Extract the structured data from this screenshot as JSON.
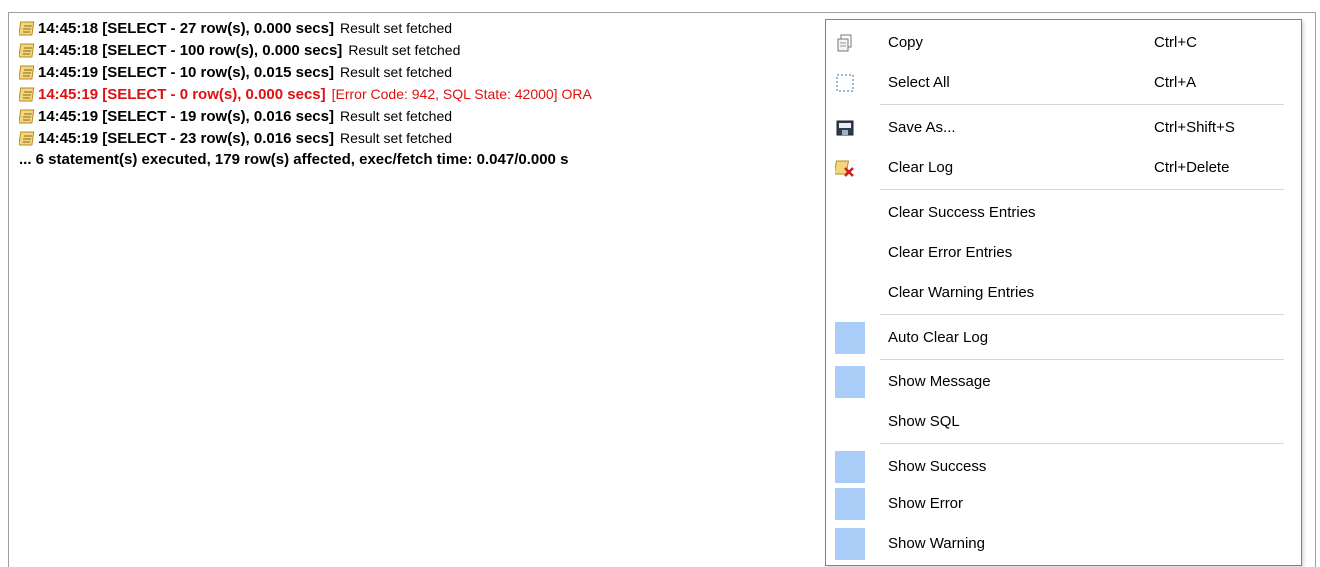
{
  "log": {
    "lines": [
      {
        "stamp": "14:45:18  [SELECT - 27 row(s), 0.000 secs]",
        "message": "Result set fetched",
        "error": false
      },
      {
        "stamp": "14:45:18  [SELECT - 100 row(s), 0.000 secs]",
        "message": "Result set fetched",
        "error": false
      },
      {
        "stamp": "14:45:19  [SELECT - 10 row(s), 0.015 secs]",
        "message": "Result set fetched",
        "error": false
      },
      {
        "stamp": "14:45:19  [SELECT - 0 row(s), 0.000 secs]",
        "message": "[Error Code: 942, SQL State: 42000]  ORA",
        "error": true
      },
      {
        "stamp": "14:45:19  [SELECT - 19 row(s), 0.016 secs]",
        "message": "Result set fetched",
        "error": false
      },
      {
        "stamp": "14:45:19  [SELECT - 23 row(s), 0.016 secs]",
        "message": "Result set fetched",
        "error": false
      }
    ],
    "summary": "... 6 statement(s) executed, 179 row(s) affected, exec/fetch time: 0.047/0.000 s"
  },
  "menu": {
    "copy": {
      "label": "Copy",
      "shortcut": "Ctrl+C",
      "icon": "copy-icon"
    },
    "select_all": {
      "label": "Select All",
      "shortcut": "Ctrl+A",
      "icon": "select-all-icon"
    },
    "save_as": {
      "label": "Save As...",
      "shortcut": "Ctrl+Shift+S",
      "icon": "save-icon"
    },
    "clear_log": {
      "label": "Clear Log",
      "shortcut": "Ctrl+Delete",
      "icon": "clear-log-icon"
    },
    "clear_success": {
      "label": "Clear Success Entries"
    },
    "clear_error": {
      "label": "Clear Error Entries"
    },
    "clear_warning": {
      "label": "Clear Warning Entries"
    },
    "auto_clear": {
      "label": "Auto Clear Log",
      "checked": true
    },
    "show_message": {
      "label": "Show Message",
      "checked": true
    },
    "show_sql": {
      "label": "Show SQL",
      "checked": false
    },
    "show_success": {
      "label": "Show Success",
      "checked": true
    },
    "show_error": {
      "label": "Show Error",
      "checked": true
    },
    "show_warning": {
      "label": "Show Warning",
      "checked": true
    }
  },
  "colors": {
    "menu_border": "#3c8ee6",
    "check_fill": "#a9cdf7",
    "error_text": "#e01010"
  }
}
